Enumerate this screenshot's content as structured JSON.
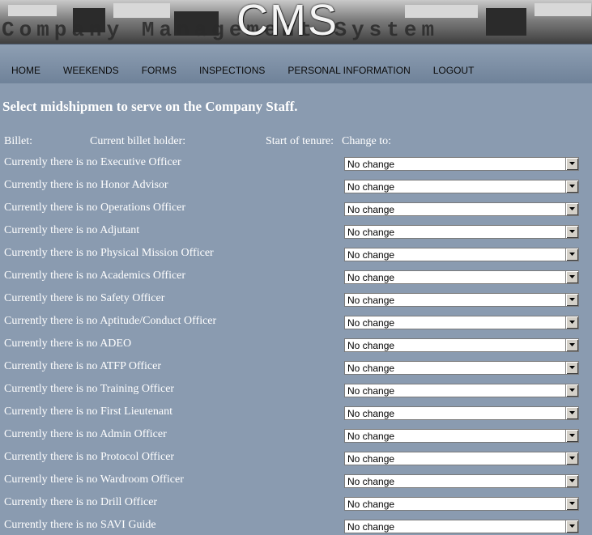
{
  "banner": {
    "title": "CMS",
    "subtitle": "Company Management System"
  },
  "nav": {
    "items": [
      "HOME",
      "WEEKENDS",
      "FORMS",
      "INSPECTIONS",
      "PERSONAL INFORMATION",
      "LOGOUT"
    ]
  },
  "page": {
    "heading": "Select midshipmen to serve on the Company Staff."
  },
  "table": {
    "headers": {
      "billet": "Billet:",
      "holder": "Current billet holder:",
      "start": "Start of tenure:",
      "change": "Change to:"
    },
    "rows": [
      {
        "label": "Currently there is no Executive Officer",
        "selected": "No change"
      },
      {
        "label": "Currently there is no Honor Advisor",
        "selected": "No change"
      },
      {
        "label": "Currently there is no Operations Officer",
        "selected": "No change"
      },
      {
        "label": "Currently there is no Adjutant",
        "selected": "No change"
      },
      {
        "label": "Currently there is no Physical Mission Officer",
        "selected": "No change"
      },
      {
        "label": "Currently there is no Academics Officer",
        "selected": "No change"
      },
      {
        "label": "Currently there is no Safety Officer",
        "selected": "No change"
      },
      {
        "label": "Currently there is no Aptitude/Conduct Officer",
        "selected": "No change"
      },
      {
        "label": "Currently there is no ADEO",
        "selected": "No change"
      },
      {
        "label": "Currently there is no ATFP Officer",
        "selected": "No change"
      },
      {
        "label": "Currently there is no Training Officer",
        "selected": "No change"
      },
      {
        "label": "Currently there is no First Lieutenant",
        "selected": "No change"
      },
      {
        "label": "Currently there is no Admin Officer",
        "selected": "No change"
      },
      {
        "label": "Currently there is no Protocol Officer",
        "selected": "No change"
      },
      {
        "label": "Currently there is no Wardroom Officer",
        "selected": "No change"
      },
      {
        "label": "Currently there is no Drill Officer",
        "selected": "No change"
      },
      {
        "label": "Currently there is no SAVI Guide",
        "selected": "No change"
      }
    ]
  },
  "colors": {
    "background": "#8a9bb0",
    "nav": "#7f91a7",
    "text": "#ffffff"
  },
  "icons": {
    "dropdown": "chevron-down-icon"
  }
}
